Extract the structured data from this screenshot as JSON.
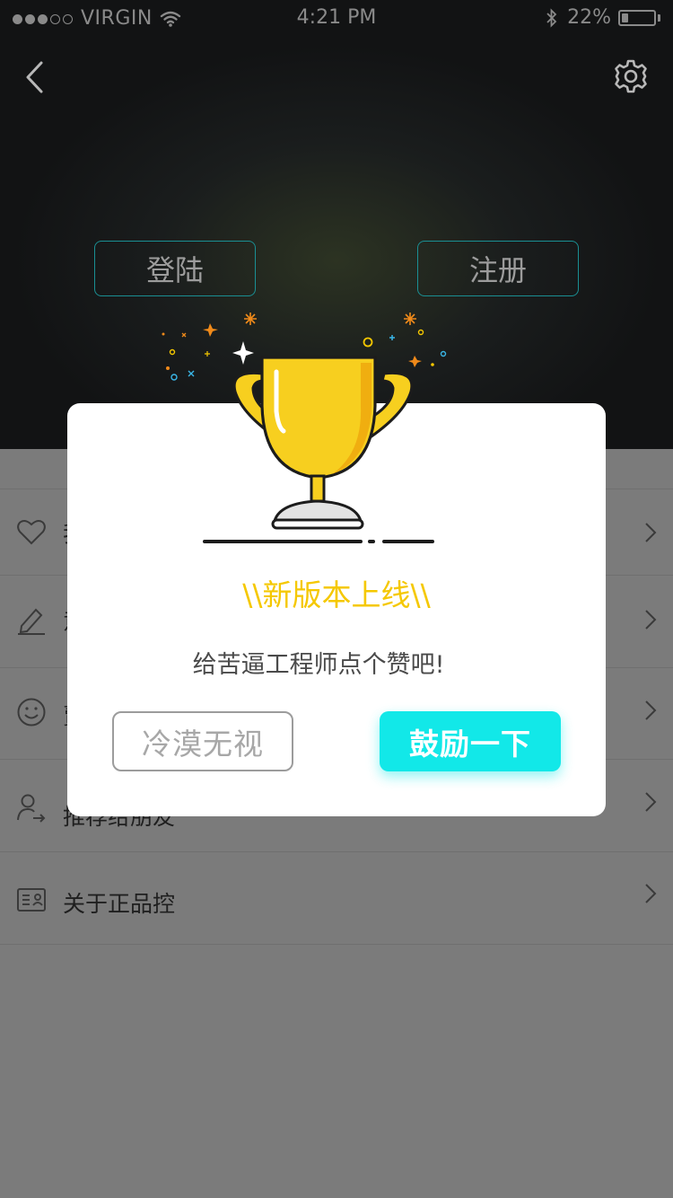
{
  "status_bar": {
    "carrier": "VIRGIN",
    "signal_dots_filled": 3,
    "signal_dots_total": 5,
    "time": "4:21 PM",
    "battery_percent_label": "22%",
    "battery_level": 0.22,
    "icons": [
      "wifi-icon",
      "bluetooth-icon",
      "battery-icon"
    ]
  },
  "nav": {
    "back_icon": "chevron-left-icon",
    "settings_icon": "gear-icon"
  },
  "auth": {
    "login_label": "登陆",
    "register_label": "注册"
  },
  "menu": {
    "items": [
      {
        "icon": "heart-icon",
        "label": "我"
      },
      {
        "icon": "pencil-icon",
        "label": "意"
      },
      {
        "icon": "smiley-icon",
        "label": "賣"
      },
      {
        "icon": "user-share-icon",
        "label": "推荐给朋友"
      },
      {
        "icon": "id-card-icon",
        "label": "关于正品控"
      }
    ]
  },
  "modal": {
    "title": "\\\\新版本上线\\\\",
    "subtitle": "给苦逼工程师点个赞吧!",
    "ignore_label": "冷漠无视",
    "cheer_label": "鼓励一下",
    "illustration": "trophy-icon"
  },
  "colors": {
    "accent_cyan": "#12e8e8",
    "title_yellow": "#f5c800",
    "trophy_gold": "#f7cf1f",
    "header_dark": "#141516",
    "overlay_gray": "#7b7b7b",
    "auth_border": "#1a8f93"
  }
}
